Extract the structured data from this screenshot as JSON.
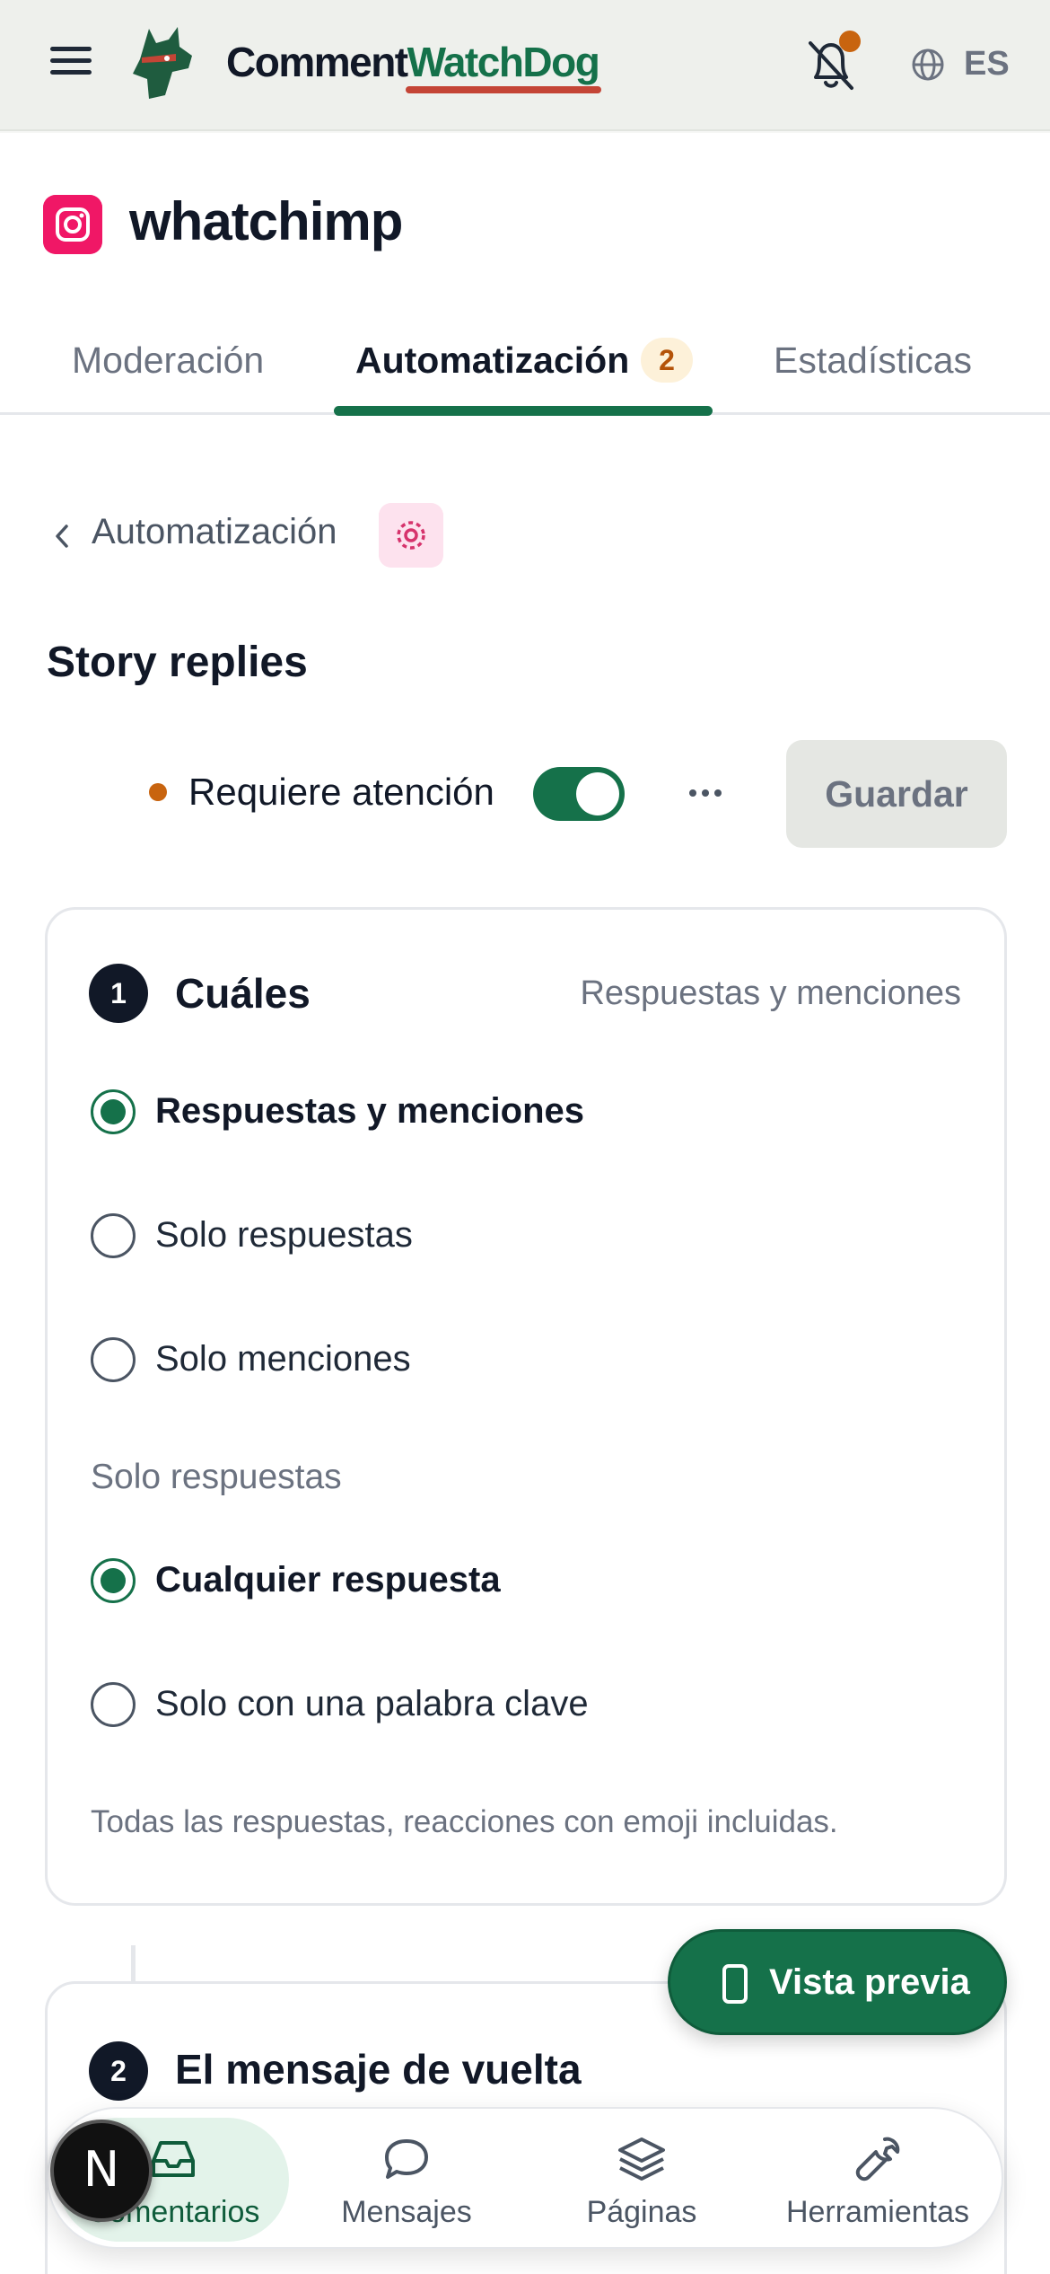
{
  "header": {
    "brand_part1": "Comment",
    "brand_part2": "WatchDog",
    "language": "ES",
    "colors": {
      "brand_green": "#15714a",
      "accent_red": "#c44536",
      "notification_dot": "#c8640f"
    }
  },
  "account": {
    "platform_icon": "instagram-icon",
    "name": "whatchimp"
  },
  "tabs": [
    {
      "label": "Moderación",
      "active": false
    },
    {
      "label": "Automatización",
      "active": true,
      "badge": "2"
    },
    {
      "label": "Estadísticas",
      "active": false
    }
  ],
  "breadcrumb": {
    "label": "Automatización",
    "icon": "story-icon"
  },
  "automation": {
    "title": "Story replies",
    "status_label": "Requiere atención",
    "enabled": true,
    "save_label": "Guardar"
  },
  "step1": {
    "number": "1",
    "title": "Cuáles",
    "summary": "Respuestas y menciones",
    "options": [
      {
        "label": "Respuestas y menciones",
        "selected": true
      },
      {
        "label": "Solo respuestas",
        "selected": false
      },
      {
        "label": "Solo menciones",
        "selected": false
      }
    ],
    "sub_heading": "Solo respuestas",
    "sub_options": [
      {
        "label": "Cualquier respuesta",
        "selected": true
      },
      {
        "label": "Solo con una palabra clave",
        "selected": false
      }
    ],
    "hint": "Todas las respuestas, reacciones con emoji incluidas."
  },
  "step2": {
    "number": "2",
    "title": "El mensaje de vuelta"
  },
  "preview_button": {
    "label": "Vista previa",
    "icon": "phone-icon"
  },
  "bottom_nav": [
    {
      "label": "Comentarios",
      "icon": "inbox-icon",
      "active": true
    },
    {
      "label": "Mensajes",
      "icon": "chat-bubble-icon",
      "active": false
    },
    {
      "label": "Páginas",
      "icon": "layers-icon",
      "active": false
    },
    {
      "label": "Herramientas",
      "icon": "wrench-icon",
      "active": false
    }
  ],
  "dev_badge": "N"
}
